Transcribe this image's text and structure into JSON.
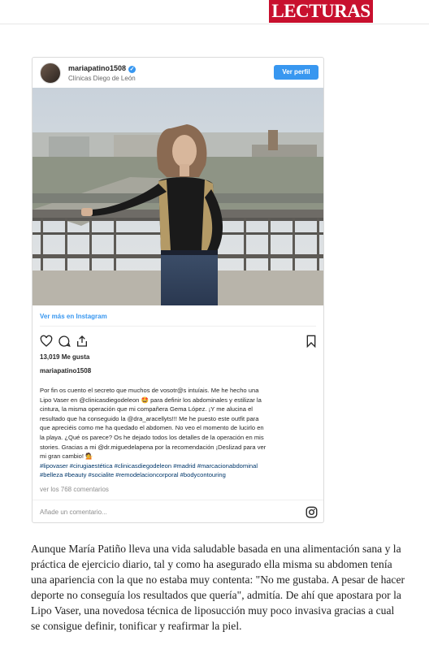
{
  "header": {
    "logo_text": "LECTURAS",
    "brand_color": "#c8102e"
  },
  "instagram": {
    "username": "mariapatino1508",
    "location": "Clínicas Diego de León",
    "follow_button": "Ver perfil",
    "see_more": "Ver más en Instagram",
    "likes": "13,019 Me gusta",
    "caption_user": "mariapatino1508",
    "caption_lines": [
      "Por fin os cuento el secreto que muchos de vosotr@s intuíais. Me he hecho una",
      "Lipo Vaser en @clinicasdiegodeleon 🤩 para definir los abdominales y estilizar la",
      "cintura, la misma operación que mi compañera Gema López. ¡Y me alucina el",
      "resultado que ha conseguido la @dra_aracellyts!!! Me he puesto este outfit para",
      "que apreciéis como me ha quedado el abdomen. No veo el momento de lucirlo en",
      "la playa. ¿Qué os parece? Os he dejado todos los detalles de la operación en mis",
      "stories. Gracias a mi @dr.miguedelapena por la recomendación ¡Deslizad para ver",
      "mi gran cambio! 💁",
      "#lipovaser #cirugiaestética #clinicasdiegodeleon #madrid #marcacionabdominal",
      "#belleza #beauty #socialite #remodelacioncorporal #bodycontouring"
    ],
    "comments_link": "ver los 768 comentarios",
    "comment_placeholder": "Añade un comentario...",
    "accent_color": "#3897f0"
  },
  "article": {
    "paragraph": "Aunque María Patiño lleva una vida saludable basada en una alimentación sana y la práctica de ejercicio diario, tal y como ha asegurado ella misma su abdomen tenía una apariencia con la que no estaba muy contenta: \"No me gustaba. A pesar de hacer deporte no conseguía los resultados que quería\", admitía. De ahí que apostara por la Lipo Vaser, una novedosa técnica de liposucción muy poco invasiva gracias a cual se consigue definir, tonificar y reafirmar la piel."
  },
  "icons": [
    "heart-icon",
    "comment-icon",
    "share-icon",
    "bookmark-icon",
    "instagram-icon",
    "verified-icon"
  ]
}
